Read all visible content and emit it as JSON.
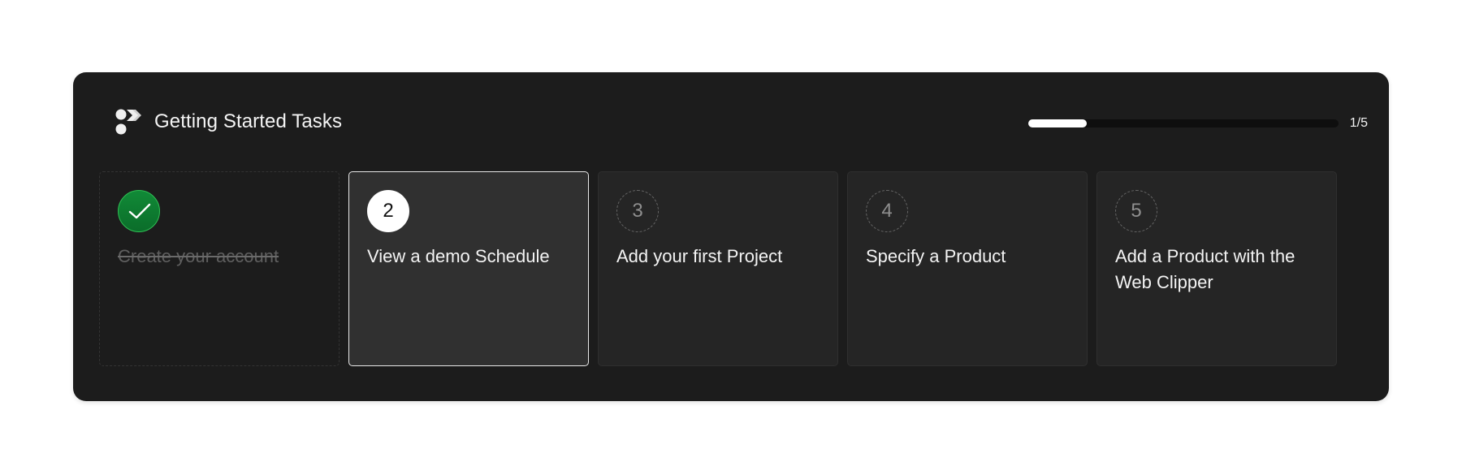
{
  "header": {
    "title": "Getting Started Tasks",
    "logo_icon": "brand-logo-icon"
  },
  "progress": {
    "completed": 1,
    "total": 5,
    "label": "1/5",
    "fill_color": "#ffffff"
  },
  "tasks": [
    {
      "number": "1",
      "label": "Create your account",
      "status": "completed",
      "icon": "checkmark-icon",
      "accent": "#118a37"
    },
    {
      "number": "2",
      "label": "View a demo Schedule",
      "status": "active"
    },
    {
      "number": "3",
      "label": "Add your first Project",
      "status": "pending"
    },
    {
      "number": "4",
      "label": "Specify a Product",
      "status": "pending"
    },
    {
      "number": "5",
      "label": "Add a Product with the Web Clipper",
      "status": "pending"
    }
  ]
}
